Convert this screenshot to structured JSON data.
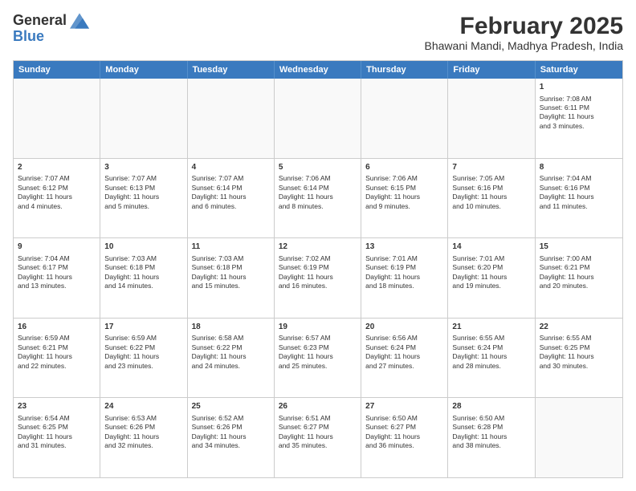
{
  "header": {
    "logo": {
      "general": "General",
      "blue": "Blue"
    },
    "month": "February 2025",
    "location": "Bhawani Mandi, Madhya Pradesh, India"
  },
  "calendar": {
    "days": [
      "Sunday",
      "Monday",
      "Tuesday",
      "Wednesday",
      "Thursday",
      "Friday",
      "Saturday"
    ],
    "weeks": [
      [
        {
          "day": "",
          "info": ""
        },
        {
          "day": "",
          "info": ""
        },
        {
          "day": "",
          "info": ""
        },
        {
          "day": "",
          "info": ""
        },
        {
          "day": "",
          "info": ""
        },
        {
          "day": "",
          "info": ""
        },
        {
          "day": "1",
          "info": "Sunrise: 7:08 AM\nSunset: 6:11 PM\nDaylight: 11 hours\nand 3 minutes."
        }
      ],
      [
        {
          "day": "2",
          "info": "Sunrise: 7:07 AM\nSunset: 6:12 PM\nDaylight: 11 hours\nand 4 minutes."
        },
        {
          "day": "3",
          "info": "Sunrise: 7:07 AM\nSunset: 6:13 PM\nDaylight: 11 hours\nand 5 minutes."
        },
        {
          "day": "4",
          "info": "Sunrise: 7:07 AM\nSunset: 6:14 PM\nDaylight: 11 hours\nand 6 minutes."
        },
        {
          "day": "5",
          "info": "Sunrise: 7:06 AM\nSunset: 6:14 PM\nDaylight: 11 hours\nand 8 minutes."
        },
        {
          "day": "6",
          "info": "Sunrise: 7:06 AM\nSunset: 6:15 PM\nDaylight: 11 hours\nand 9 minutes."
        },
        {
          "day": "7",
          "info": "Sunrise: 7:05 AM\nSunset: 6:16 PM\nDaylight: 11 hours\nand 10 minutes."
        },
        {
          "day": "8",
          "info": "Sunrise: 7:04 AM\nSunset: 6:16 PM\nDaylight: 11 hours\nand 11 minutes."
        }
      ],
      [
        {
          "day": "9",
          "info": "Sunrise: 7:04 AM\nSunset: 6:17 PM\nDaylight: 11 hours\nand 13 minutes."
        },
        {
          "day": "10",
          "info": "Sunrise: 7:03 AM\nSunset: 6:18 PM\nDaylight: 11 hours\nand 14 minutes."
        },
        {
          "day": "11",
          "info": "Sunrise: 7:03 AM\nSunset: 6:18 PM\nDaylight: 11 hours\nand 15 minutes."
        },
        {
          "day": "12",
          "info": "Sunrise: 7:02 AM\nSunset: 6:19 PM\nDaylight: 11 hours\nand 16 minutes."
        },
        {
          "day": "13",
          "info": "Sunrise: 7:01 AM\nSunset: 6:19 PM\nDaylight: 11 hours\nand 18 minutes."
        },
        {
          "day": "14",
          "info": "Sunrise: 7:01 AM\nSunset: 6:20 PM\nDaylight: 11 hours\nand 19 minutes."
        },
        {
          "day": "15",
          "info": "Sunrise: 7:00 AM\nSunset: 6:21 PM\nDaylight: 11 hours\nand 20 minutes."
        }
      ],
      [
        {
          "day": "16",
          "info": "Sunrise: 6:59 AM\nSunset: 6:21 PM\nDaylight: 11 hours\nand 22 minutes."
        },
        {
          "day": "17",
          "info": "Sunrise: 6:59 AM\nSunset: 6:22 PM\nDaylight: 11 hours\nand 23 minutes."
        },
        {
          "day": "18",
          "info": "Sunrise: 6:58 AM\nSunset: 6:22 PM\nDaylight: 11 hours\nand 24 minutes."
        },
        {
          "day": "19",
          "info": "Sunrise: 6:57 AM\nSunset: 6:23 PM\nDaylight: 11 hours\nand 25 minutes."
        },
        {
          "day": "20",
          "info": "Sunrise: 6:56 AM\nSunset: 6:24 PM\nDaylight: 11 hours\nand 27 minutes."
        },
        {
          "day": "21",
          "info": "Sunrise: 6:55 AM\nSunset: 6:24 PM\nDaylight: 11 hours\nand 28 minutes."
        },
        {
          "day": "22",
          "info": "Sunrise: 6:55 AM\nSunset: 6:25 PM\nDaylight: 11 hours\nand 30 minutes."
        }
      ],
      [
        {
          "day": "23",
          "info": "Sunrise: 6:54 AM\nSunset: 6:25 PM\nDaylight: 11 hours\nand 31 minutes."
        },
        {
          "day": "24",
          "info": "Sunrise: 6:53 AM\nSunset: 6:26 PM\nDaylight: 11 hours\nand 32 minutes."
        },
        {
          "day": "25",
          "info": "Sunrise: 6:52 AM\nSunset: 6:26 PM\nDaylight: 11 hours\nand 34 minutes."
        },
        {
          "day": "26",
          "info": "Sunrise: 6:51 AM\nSunset: 6:27 PM\nDaylight: 11 hours\nand 35 minutes."
        },
        {
          "day": "27",
          "info": "Sunrise: 6:50 AM\nSunset: 6:27 PM\nDaylight: 11 hours\nand 36 minutes."
        },
        {
          "day": "28",
          "info": "Sunrise: 6:50 AM\nSunset: 6:28 PM\nDaylight: 11 hours\nand 38 minutes."
        },
        {
          "day": "",
          "info": ""
        }
      ]
    ]
  }
}
